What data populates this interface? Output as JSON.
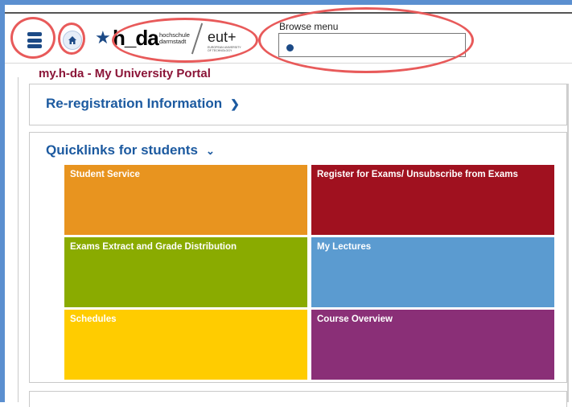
{
  "header": {
    "logo": {
      "brand": "h_da",
      "sub_line1": "hochschule",
      "sub_line2": "darmstadt",
      "partner": "eut+",
      "partner_sub": "EUROPEAN UNIVERSITY OF TECHNOLOGY"
    },
    "browse_menu": {
      "label": "Browse menu",
      "value": "",
      "placeholder": ""
    }
  },
  "portal_title": "my.h-da - My University Portal",
  "panels": {
    "reregistration": {
      "title": "Re-registration Information",
      "state": "collapsed"
    },
    "quicklinks": {
      "title": "Quicklinks for students",
      "state": "expanded",
      "tiles": [
        {
          "label": "Student Service",
          "color": "#e8941f"
        },
        {
          "label": "Register for Exams/ Unsubscribe from Exams",
          "color": "#a0111f"
        },
        {
          "label": "Exams Extract and Grade Distribution",
          "color": "#8aab00"
        },
        {
          "label": "My Lectures",
          "color": "#5b9bd0"
        },
        {
          "label": "Schedules",
          "color": "#ffcc00"
        },
        {
          "label": "Course Overview",
          "color": "#8a2f77"
        }
      ]
    }
  },
  "colors": {
    "brand_blue": "#1c4a86",
    "title_red": "#8b1538",
    "annotation_red": "#e85a5a"
  },
  "icons": [
    "menu-icon",
    "home-icon",
    "star-icon",
    "search-icon",
    "chevron-right-icon",
    "chevron-down-icon"
  ]
}
